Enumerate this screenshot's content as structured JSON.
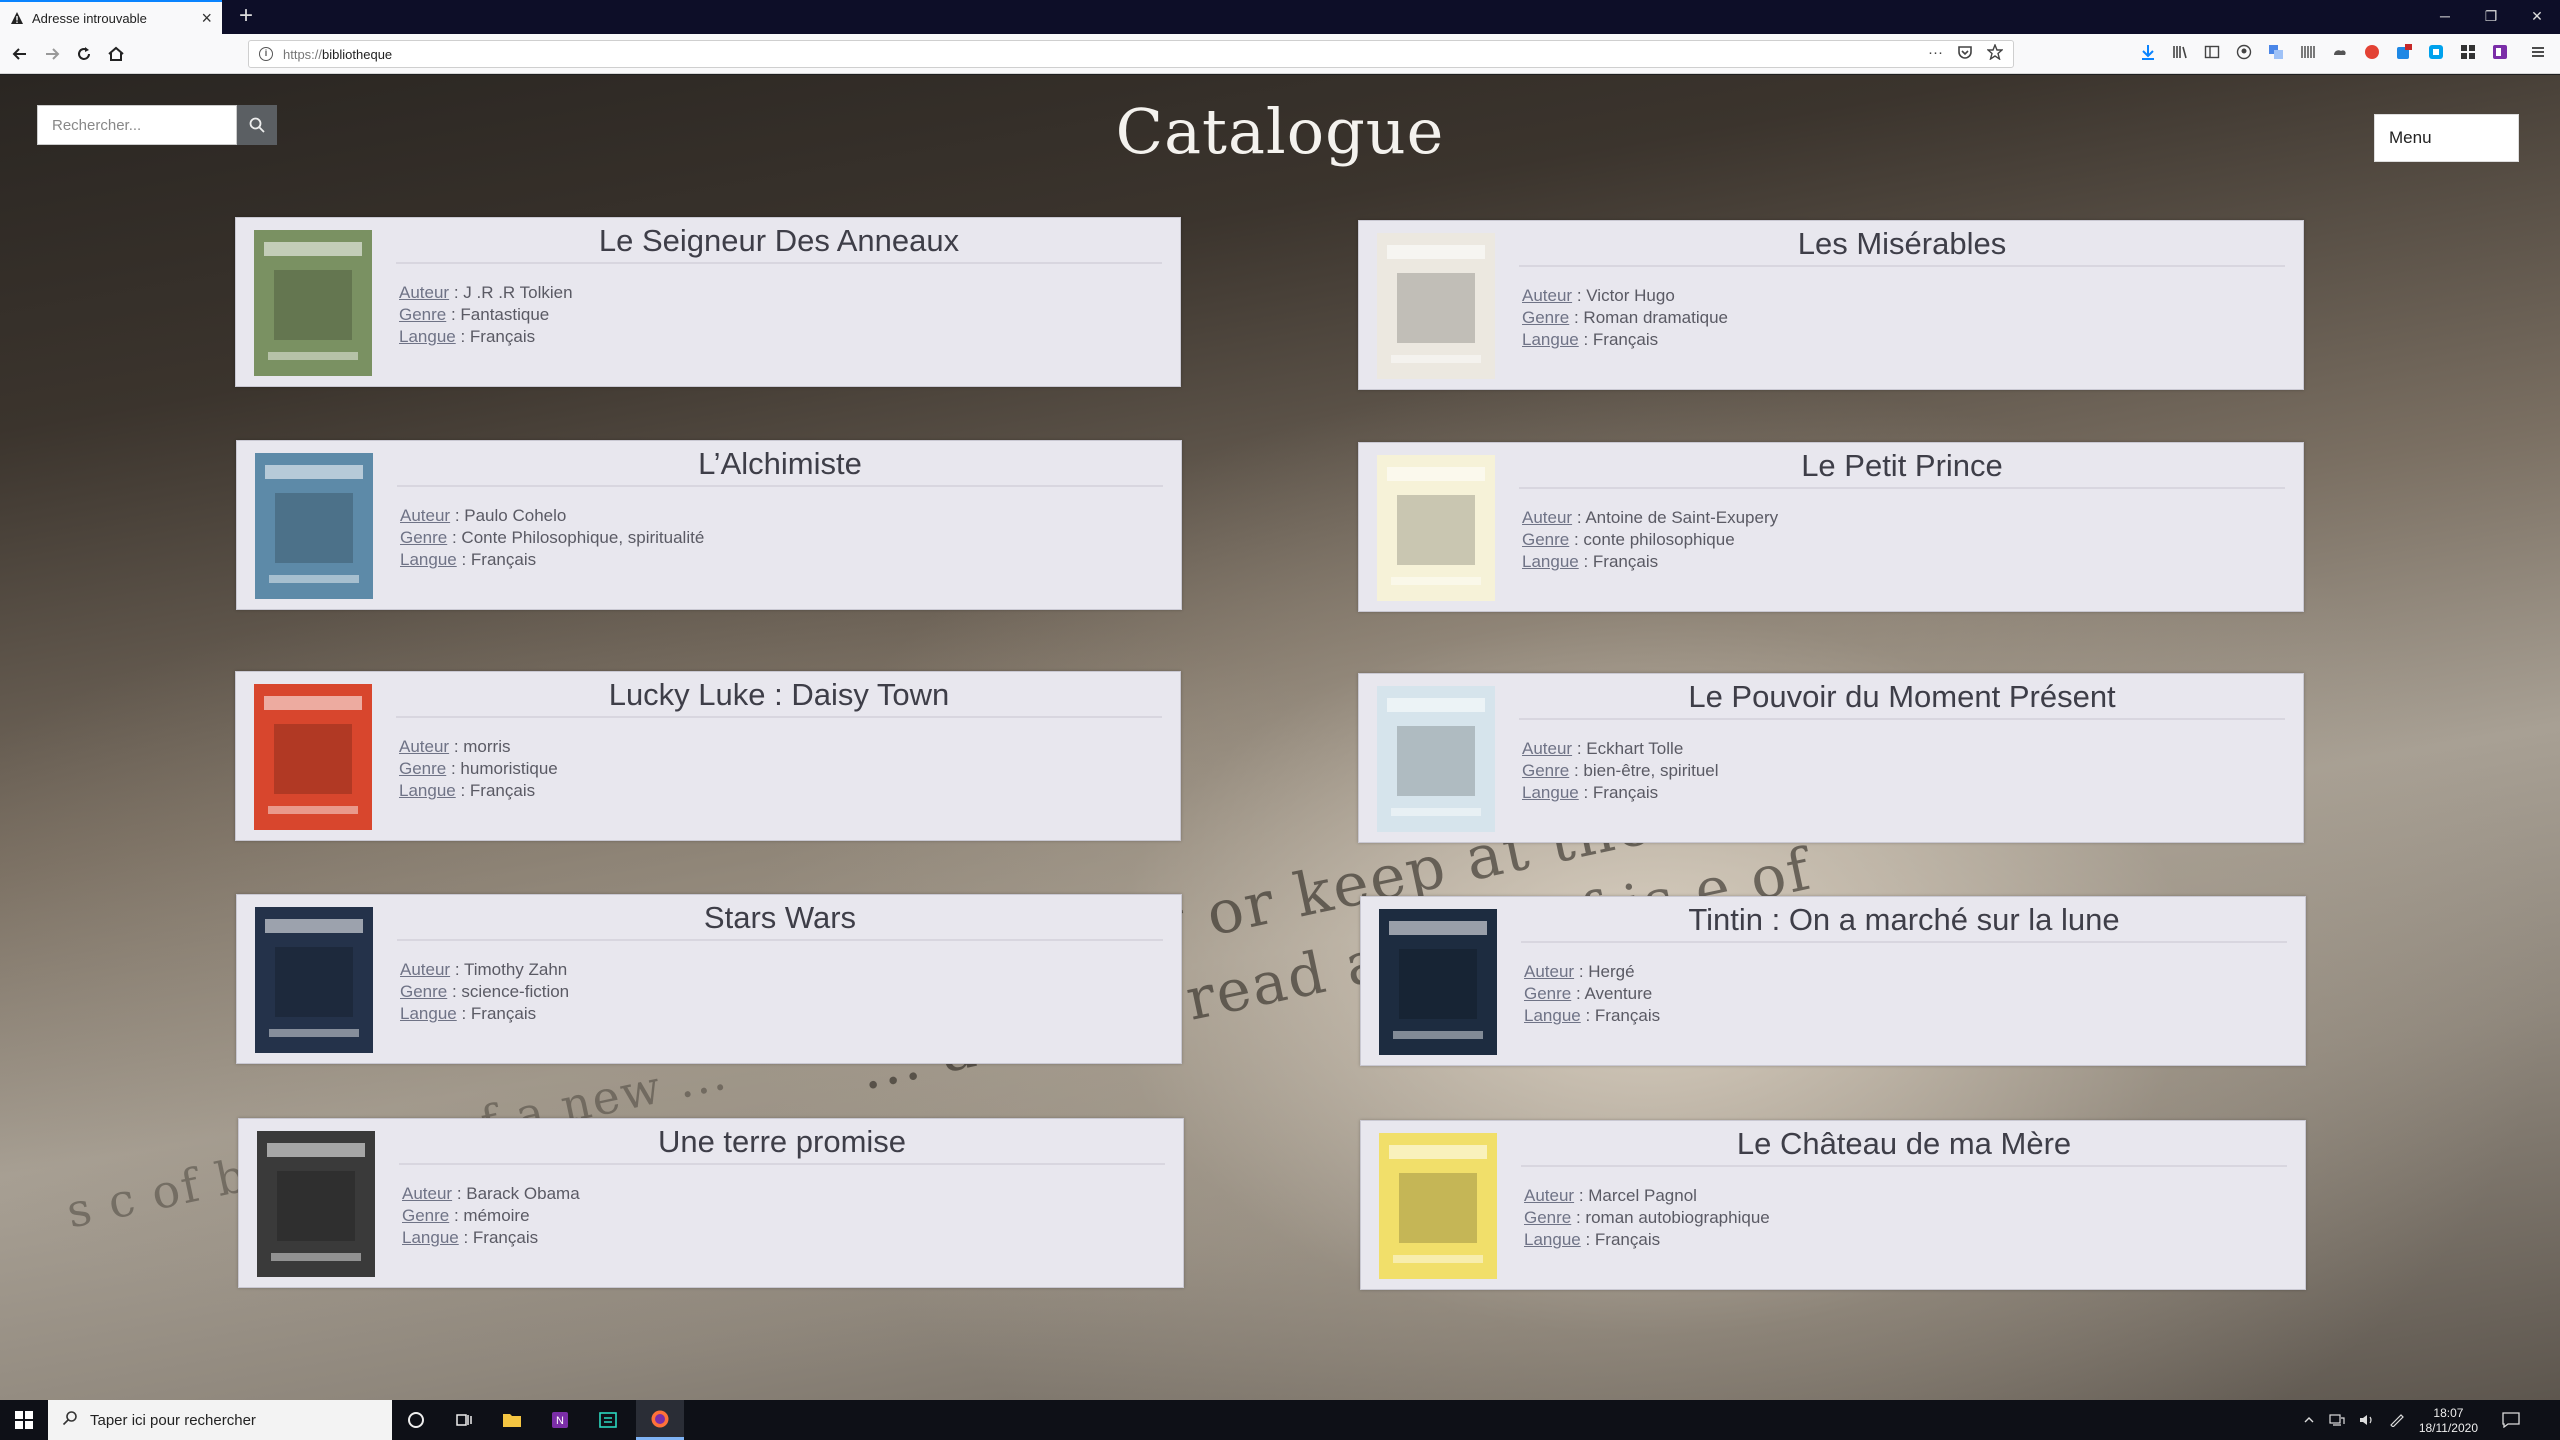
{
  "browser": {
    "tab_title": "Adresse introuvable",
    "tab_close": "×",
    "new_tab": "+",
    "url_protocol": "https://",
    "url_host": "bibliotheque",
    "url_more": "···",
    "win_minimize": "─",
    "win_restore": "❐",
    "win_close": "✕"
  },
  "header": {
    "search_placeholder": "Rechercher...",
    "title": "Catalogue",
    "menu_label": "Menu"
  },
  "labels": {
    "author": "Auteur",
    "genre": "Genre",
    "language": "Langue"
  },
  "books": [
    {
      "title": "Le Seigneur Des Anneaux",
      "author": " : J .R .R Tolkien",
      "genre": " : Fantastique",
      "language": " : Français",
      "cover_color": "#7a9162"
    },
    {
      "title": "Les Misérables",
      "author": " : Victor Hugo",
      "genre": " : Roman dramatique",
      "language": " : Français",
      "cover_color": "#ece8e0"
    },
    {
      "title": "L’Alchimiste",
      "author": " : Paulo Cohelo",
      "genre": " : Conte Philosophique, spiritualité",
      "language": " : Français",
      "cover_color": "#5d8aa8"
    },
    {
      "title": "Le Petit Prince",
      "author": " :  Antoine de Saint-Exupery",
      "genre": " : conte philosophique",
      "language": " : Français",
      "cover_color": "#f6f2d8"
    },
    {
      "title": "Lucky Luke : Daisy Town",
      "author": " : morris",
      "genre": " : humoristique",
      "language": " : Français",
      "cover_color": "#d8462d"
    },
    {
      "title": "Le Pouvoir du Moment Présent",
      "author": " : Eckhart Tolle",
      "genre": " : bien-être, spirituel",
      "language": " : Français",
      "cover_color": "#d6e4ec"
    },
    {
      "title": "Stars Wars",
      "author": " : Timothy Zahn",
      "genre": " : science-fiction",
      "language": " : Français",
      "cover_color": "#24324a"
    },
    {
      "title": "Tintin : On a marché sur la lune",
      "author": " : Hergé",
      "genre": " : Aventure",
      "language": " : Français",
      "cover_color": "#1d2c40"
    },
    {
      "title": "Une terre promise",
      "author": " : Barack Obama",
      "genre": " :  mémoire",
      "language": " : Français",
      "cover_color": "#3a3a3a"
    },
    {
      "title": "Le Château de ma Mère",
      "author": " : Marcel Pagnol",
      "genre": " : roman autobiographique",
      "language": " : Français",
      "cover_color": "#f1df6a"
    }
  ],
  "taskbar": {
    "search_placeholder": "Taper ici pour rechercher",
    "time": "18:07",
    "date": "18/11/2020"
  }
}
